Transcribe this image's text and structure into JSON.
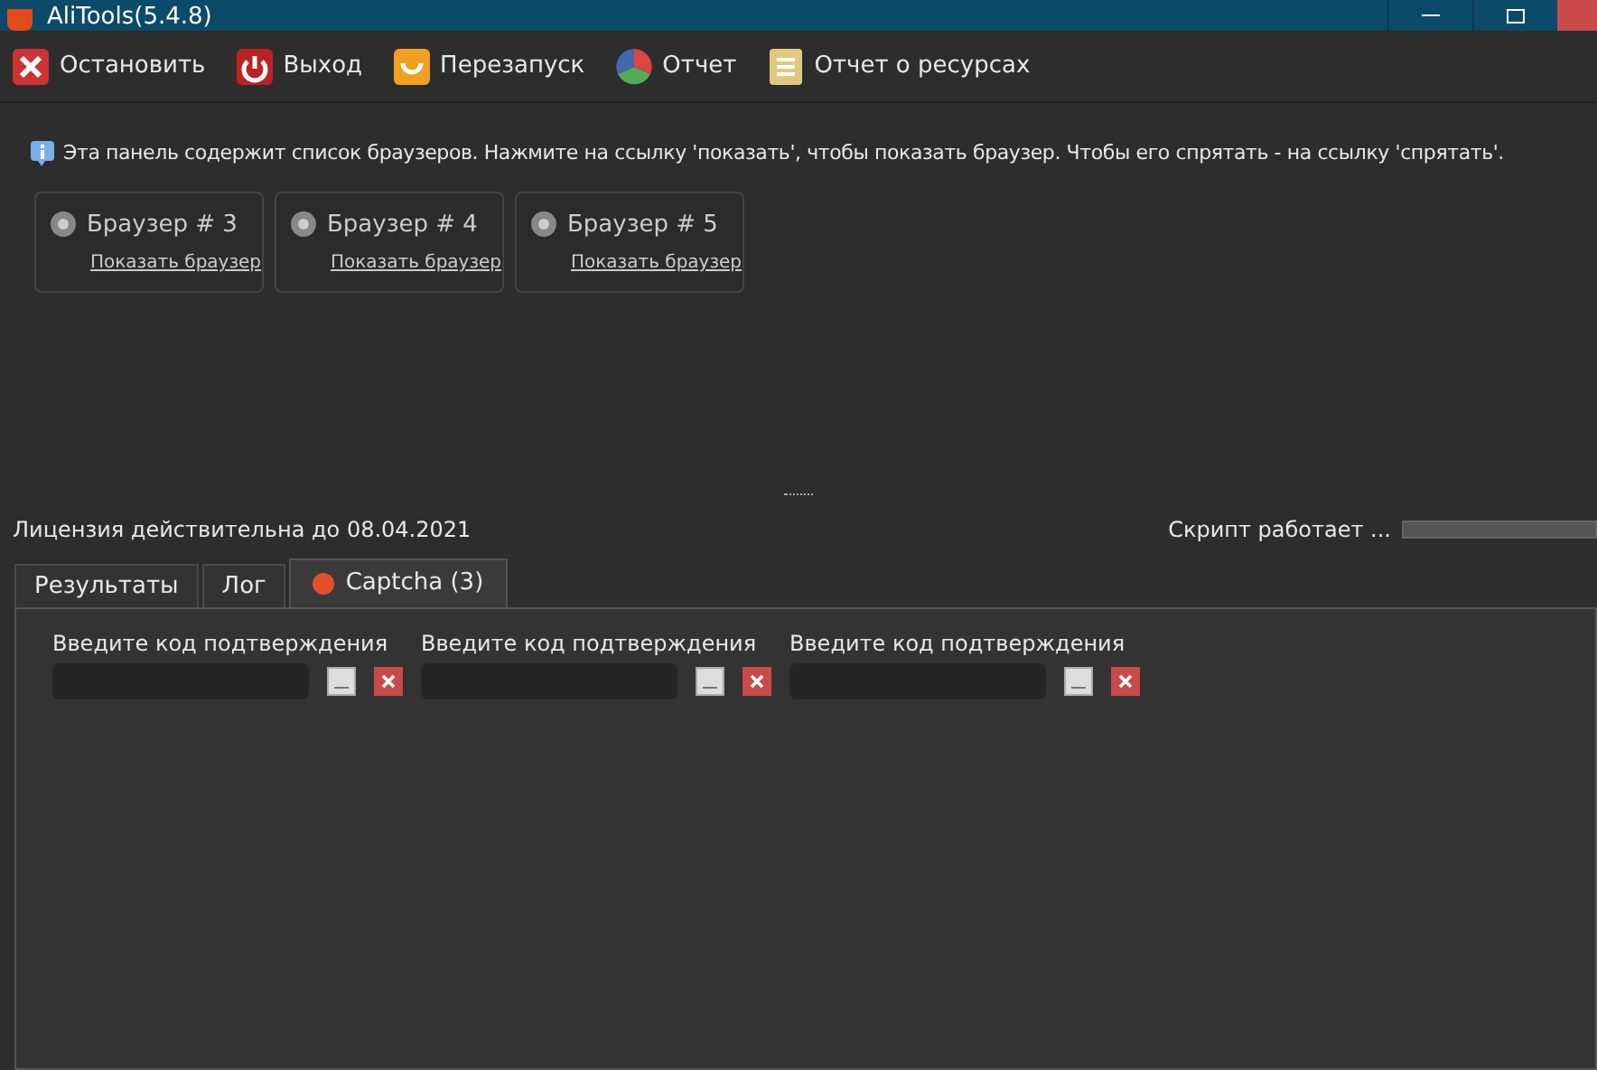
{
  "window": {
    "title": "AliTools(5.4.8)"
  },
  "toolbar": [
    {
      "label": "Остановить",
      "kind": "stop"
    },
    {
      "label": "Выход",
      "kind": "exit"
    },
    {
      "label": "Перезапуск",
      "kind": "restart"
    },
    {
      "label": "Отчет",
      "kind": "report"
    },
    {
      "label": "Отчет о ресурсах",
      "kind": "resources"
    }
  ],
  "info": "Эта панель содержит список браузеров. Нажмите на ссылку 'показать', чтобы показать браузер. Чтобы его спрятать - на ссылку 'спрятать'.",
  "browsers": [
    {
      "name": "Браузер # 3",
      "link": "Показать браузер"
    },
    {
      "name": "Браузер # 4",
      "link": "Показать браузер"
    },
    {
      "name": "Браузер # 5",
      "link": "Показать браузер"
    }
  ],
  "status": {
    "license": "Лицензия действительна до 08.04.2021",
    "script": "Скрипт работает ...",
    "level": 1
  },
  "tabs": [
    {
      "label": "Результаты",
      "selected": false
    },
    {
      "label": "Лог",
      "selected": false
    },
    {
      "label": "Captcha (3)",
      "selected": true
    }
  ],
  "captchas": [
    {
      "label": "Введите код подтверждения"
    },
    {
      "label": "Введите код подтверждения"
    },
    {
      "label": "Введите код подтверждения"
    }
  ]
}
